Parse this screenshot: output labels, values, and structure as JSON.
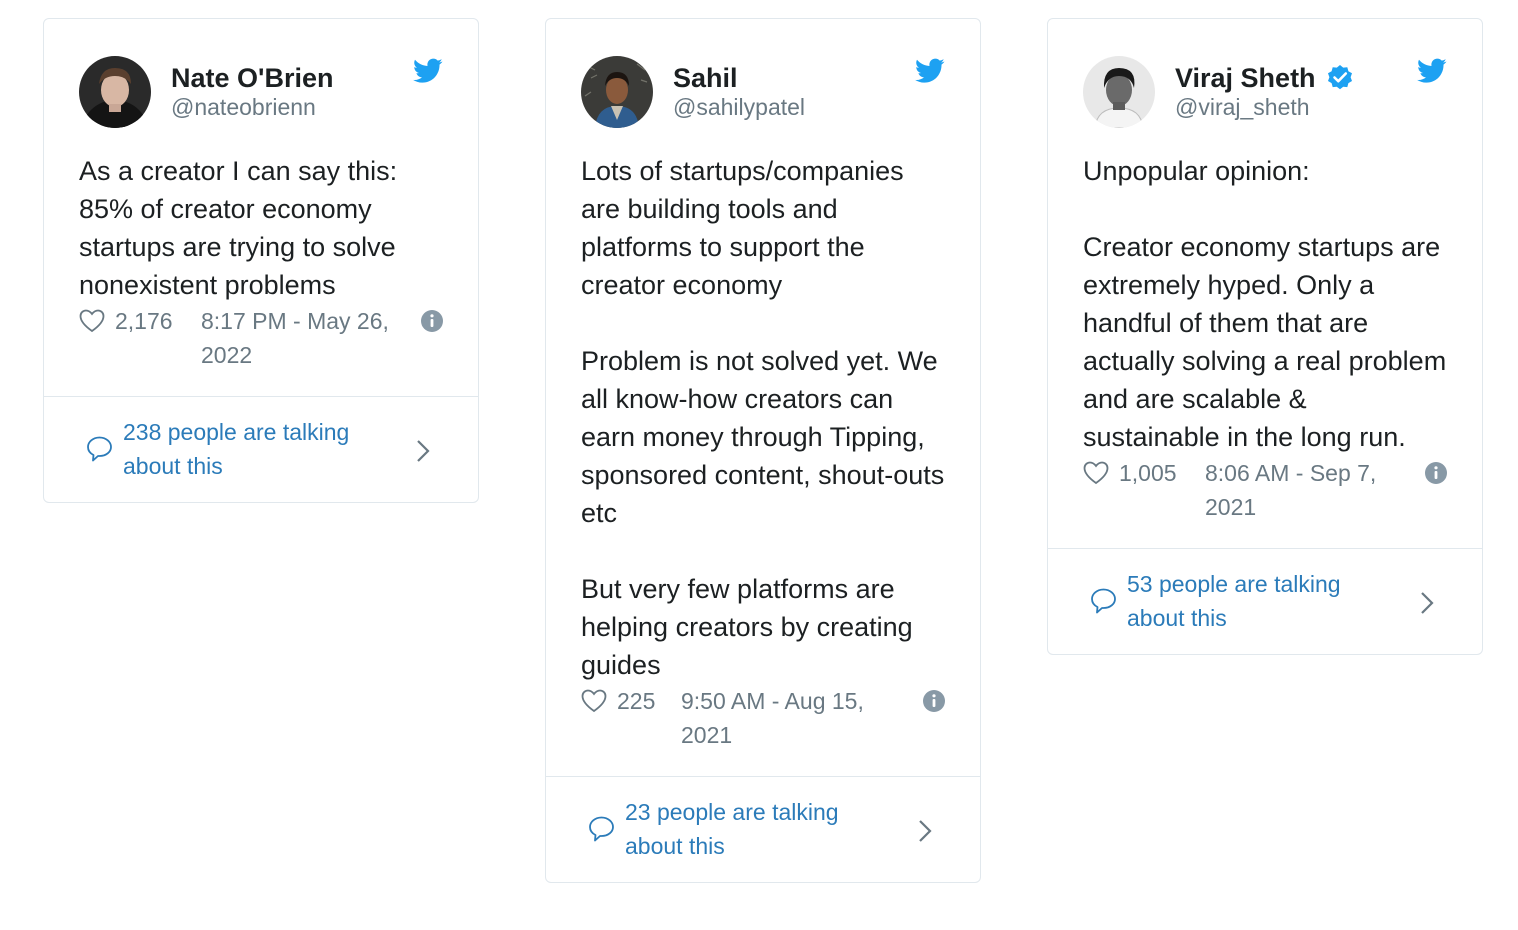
{
  "tweets": [
    {
      "name": "Nate O'Brien",
      "handle": "@nateobrienn",
      "verified": false,
      "text": "As a creator I can say this: 85% of creator economy startups are trying to solve nonexistent problems",
      "likes": "2,176",
      "timestamp": "8:17 PM - May 26, 2022",
      "talking": "238 people are talking about this"
    },
    {
      "name": "Sahil",
      "handle": "@sahilypatel",
      "verified": false,
      "text": "Lots of startups/companies are building tools and platforms to support the creator economy\n\nProblem is not solved yet. We all know-how creators can earn money through Tipping, sponsored content, shout-outs etc\n\nBut very few platforms are helping creators by creating guides",
      "likes": "225",
      "timestamp": "9:50 AM - Aug 15, 2021",
      "talking": "23 people are talking about this"
    },
    {
      "name": "Viraj Sheth",
      "handle": "@viraj_sheth",
      "verified": true,
      "text": "Unpopular opinion:\n\nCreator economy startups are extremely hyped. Only a handful of them that are actually solving a real problem and are scalable & sustainable in the long run.",
      "likes": "1,005",
      "timestamp": "8:06 AM - Sep 7, 2021",
      "talking": "53 people are talking about this"
    }
  ],
  "colors": {
    "twitter_blue": "#1da1f2",
    "link_blue": "#2b7bb9",
    "muted": "#697882",
    "border": "#e1e8ed",
    "text": "#1c2022"
  },
  "icons": {
    "brand": "twitter-bird-icon",
    "like": "heart-icon",
    "info": "info-icon",
    "reply": "speech-bubble-icon",
    "more": "chevron-right-icon",
    "verified": "verified-badge-icon"
  }
}
